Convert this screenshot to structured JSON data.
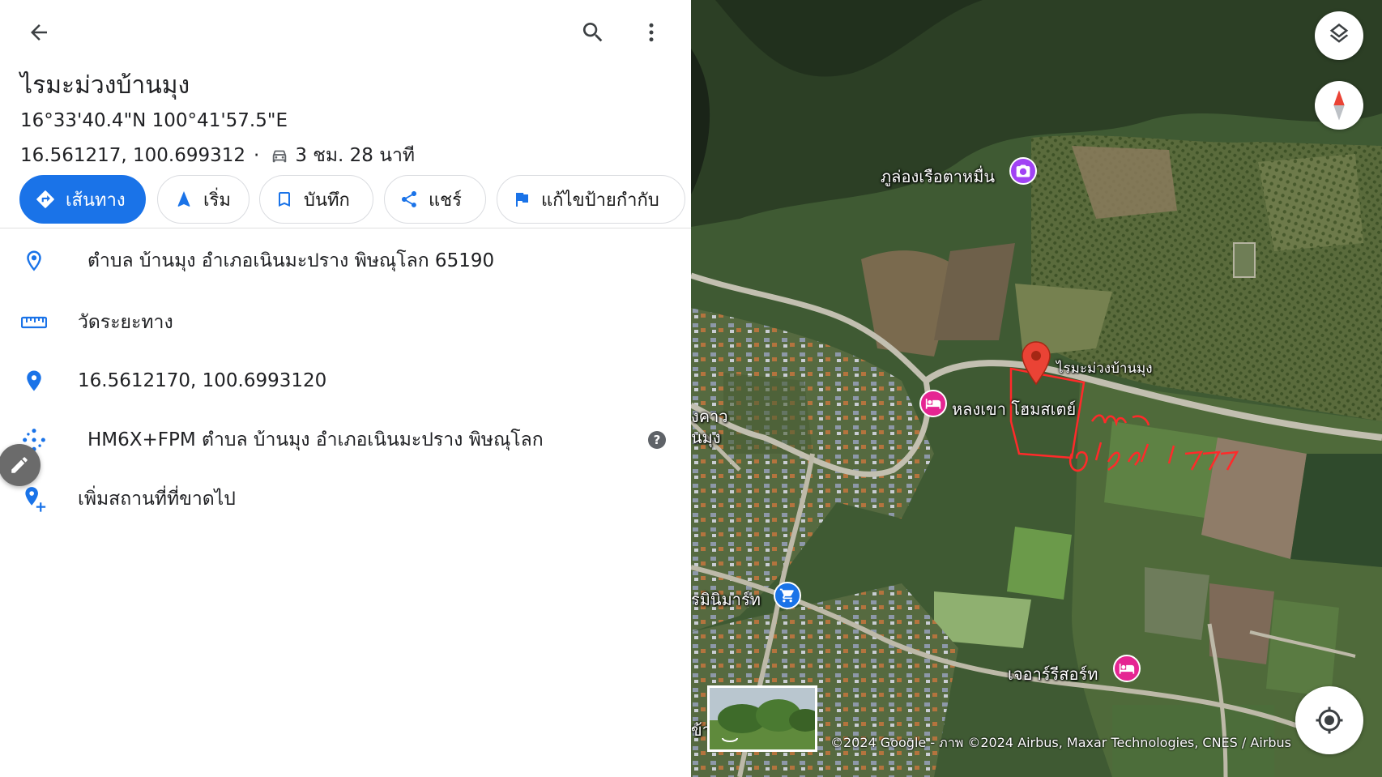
{
  "place": {
    "title": "ไรมะม่วงบ้านมุง",
    "dms": "16°33'40.4\"N 100°41'57.5\"E",
    "decimal": "16.561217, 100.699312",
    "separator": "·",
    "drive_time": "3 ชม. 28 นาที"
  },
  "chips": {
    "directions": "เส้นทาง",
    "start": "เริ่ม",
    "save": "บันทึก",
    "share": "แชร์",
    "label": "แก้ไขป้ายกำกับ"
  },
  "rows": {
    "address": "ตำบล บ้านมุง อำเภอเนินมะปราง พิษณุโลก 65190",
    "measure": "วัดระยะทาง",
    "coords": "16.5612170, 100.6993120",
    "pluscode": "HM6X+FPM ตำบล บ้านมุง อำเภอเนินมะปราง พิษณุโลก",
    "help": "?",
    "missing": "เพิ่มสถานที่ที่ขาดไป"
  },
  "map": {
    "labels": {
      "cave": "ภูล่องเรือตาหมื่น",
      "orchard": "ไรมะม่วงบ้านมุง",
      "homestay": "หลงเขา โฮมสเตย์",
      "mart": "รมินิมาร์ท",
      "resort": "เจอาร์รีสอร์ท",
      "edge1": "งคาว",
      "edge2": "นมุง",
      "edge3": "ข้าง"
    },
    "attribution": "©2024 Google - ภาพ ©2024 Airbus, Maxar Technologies, CNES / Airbus"
  },
  "colors": {
    "accent": "#1a73e8",
    "pin": "#ea4335",
    "poi_purple": "#a142f4",
    "poi_pink": "#e52592",
    "poi_blue": "#1a73e8"
  },
  "icons": [
    "back-arrow-icon",
    "search-icon",
    "more-vert-icon",
    "car-icon",
    "directions-icon",
    "navigation-icon",
    "bookmark-icon",
    "share-icon",
    "flag-icon",
    "location-outline-icon",
    "ruler-icon",
    "location-pin-icon",
    "plus-code-icon",
    "help-icon",
    "add-place-icon",
    "pencil-icon",
    "layers-icon",
    "compass-icon",
    "my-location-icon",
    "camera-icon",
    "bed-icon",
    "cart-icon"
  ]
}
